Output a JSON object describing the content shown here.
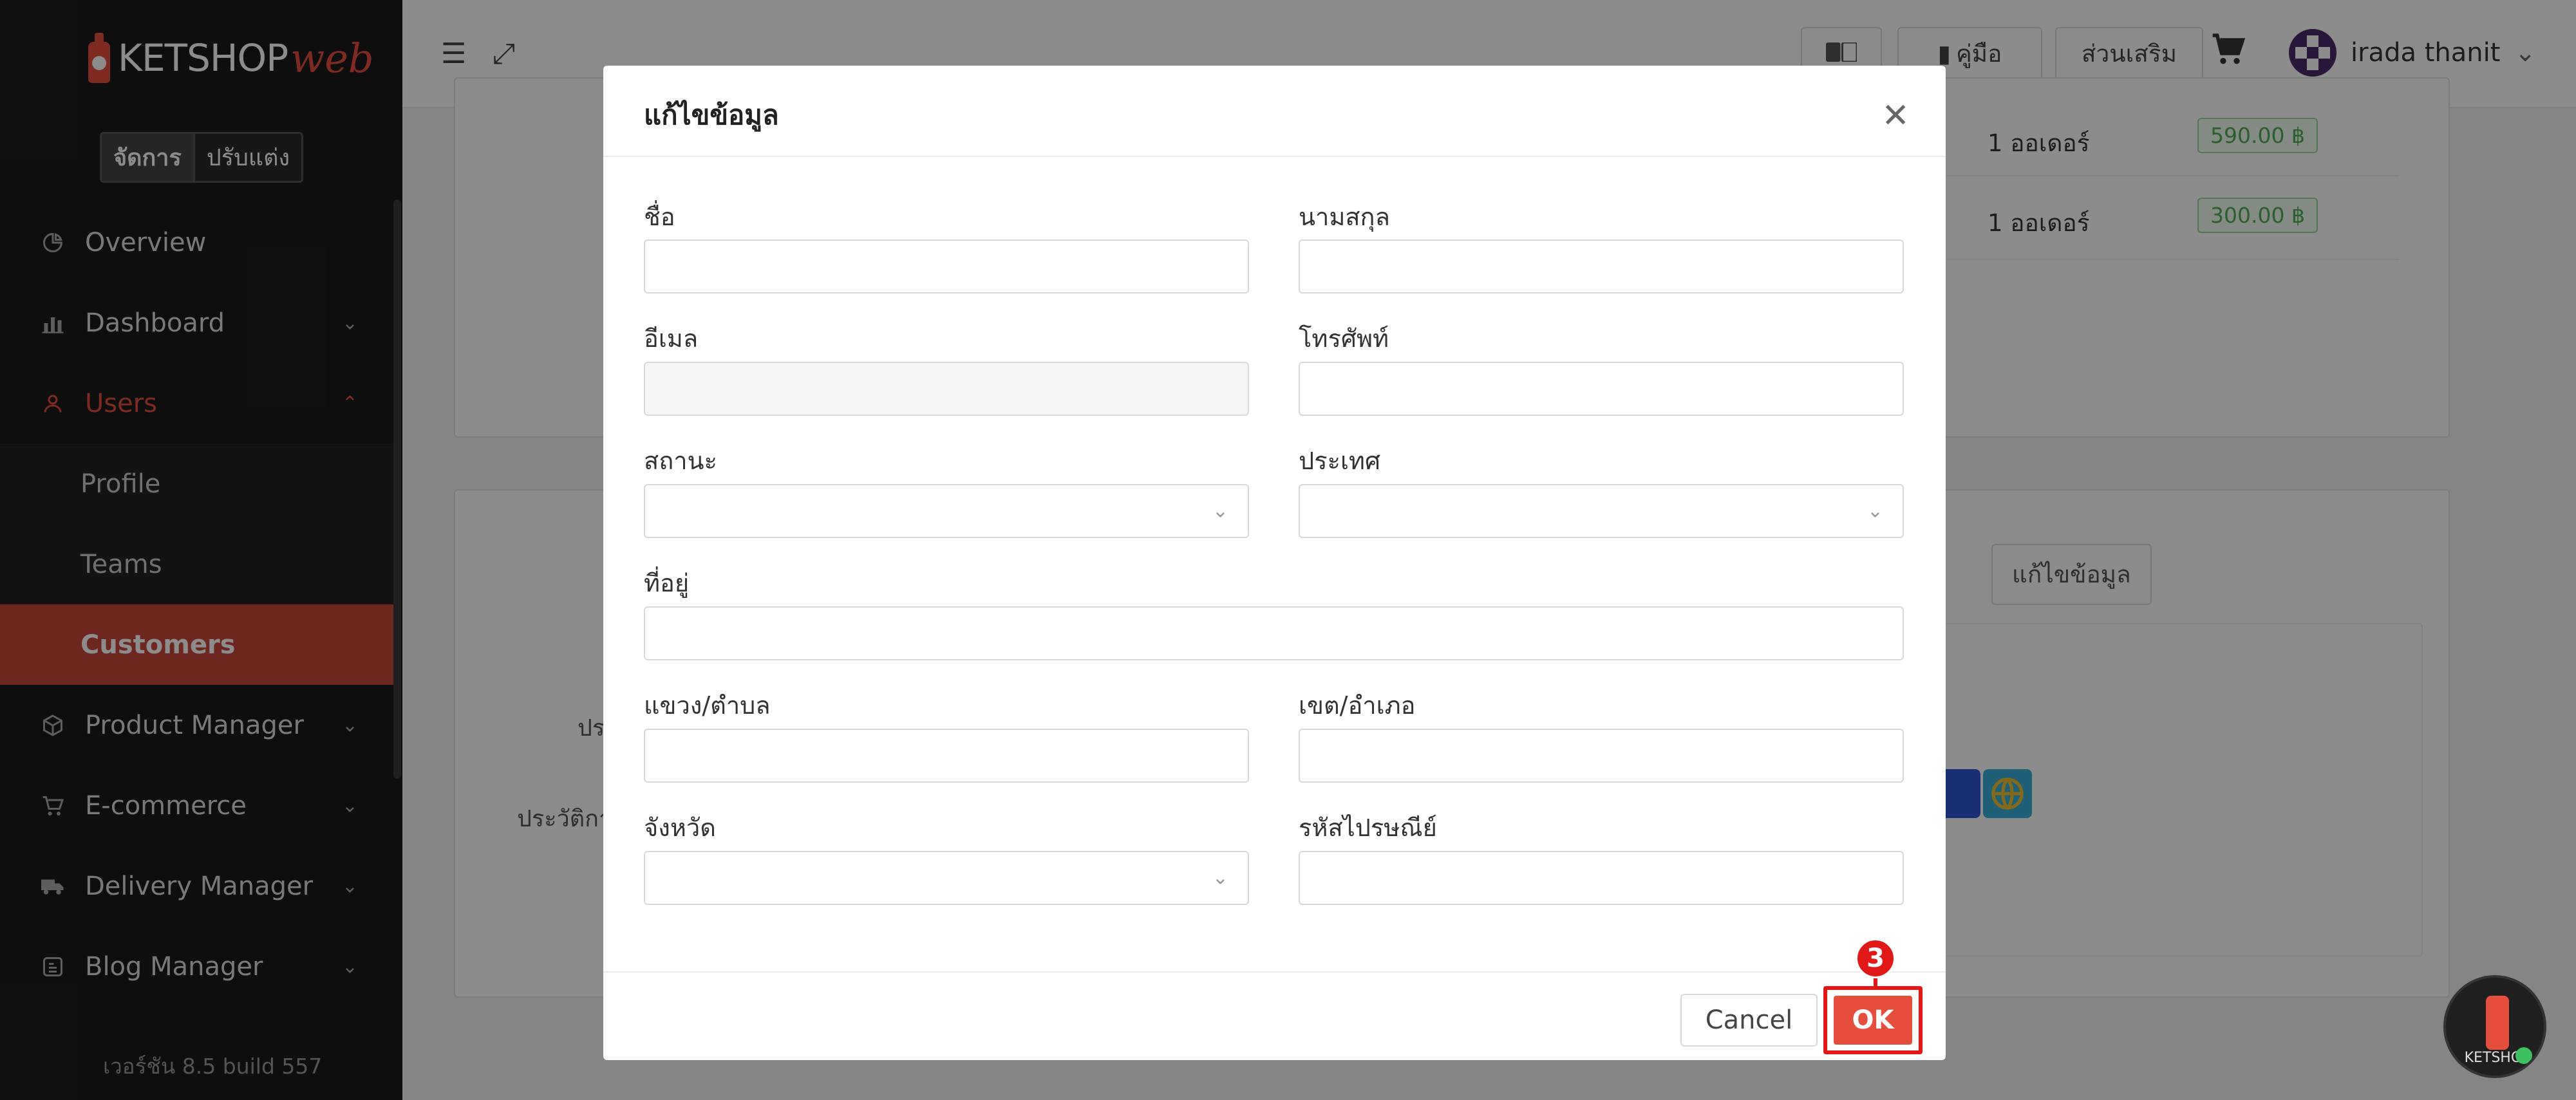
{
  "sidebar": {
    "logo_text": "KETSHOP",
    "logo_web": "web",
    "mode_manage": "จัดการ",
    "mode_customize": "ปรับแต่ง",
    "items": [
      {
        "label": "Overview",
        "icon": "pie-chart-icon"
      },
      {
        "label": "Dashboard",
        "icon": "bar-chart-icon"
      },
      {
        "label": "Users",
        "icon": "user-icon"
      },
      {
        "label": "Profile"
      },
      {
        "label": "Teams"
      },
      {
        "label": "Customers"
      },
      {
        "label": "Product Manager",
        "icon": "box-icon"
      },
      {
        "label": "E-commerce",
        "icon": "cart-icon"
      },
      {
        "label": "Delivery Manager",
        "icon": "truck-icon"
      },
      {
        "label": "Blog Manager",
        "icon": "blog-icon"
      }
    ],
    "version": "เวอร์ชัน 8.5 build 557"
  },
  "topbar": {
    "manual_label": "คู่มือ",
    "addons_label": "ส่วนเสริม",
    "user_name": "irada thanit"
  },
  "background": {
    "orders": [
      {
        "count": "1 ออเดอร์",
        "amount": "590.00 ฿"
      },
      {
        "count": "1 ออเดอร์",
        "amount": "300.00 ฿"
      }
    ],
    "edit_button": "แก้ไขข้อมูล",
    "label_1": "ปร",
    "label_2": "ประวัติกา"
  },
  "modal": {
    "title": "แก้ไขข้อมูล",
    "fields": {
      "first_name": {
        "label": "ชื่อ",
        "value": ""
      },
      "last_name": {
        "label": "นามสกุล",
        "value": ""
      },
      "email": {
        "label": "อีเมล",
        "value": ""
      },
      "phone": {
        "label": "โทรศัพท์",
        "value": ""
      },
      "status": {
        "label": "สถานะ",
        "value": ""
      },
      "country": {
        "label": "ประเทศ",
        "value": ""
      },
      "address": {
        "label": "ที่อยู่",
        "value": ""
      },
      "subdistrict": {
        "label": "แขวง/ตำบล",
        "value": ""
      },
      "district": {
        "label": "เขต/อำเภอ",
        "value": ""
      },
      "province": {
        "label": "จังหวัด",
        "value": ""
      },
      "postal_code": {
        "label": "รหัสไปรษณีย์",
        "value": ""
      }
    },
    "cancel_label": "Cancel",
    "ok_label": "OK",
    "step_number": "3"
  },
  "help_fab_text": "KETSHOP",
  "colors": {
    "accent": "#e54d3d",
    "highlight": "#e01818",
    "sidebar_bg": "#1b1b1b",
    "price_green": "#4caf50"
  }
}
